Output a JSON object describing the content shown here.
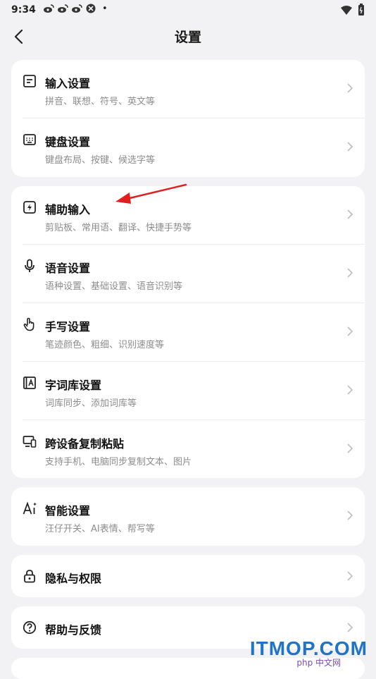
{
  "status": {
    "time": "9:34",
    "notif_icons": [
      "weibo-icon",
      "weibo-icon",
      "weibo-icon",
      "app-icon",
      "dot-icon"
    ]
  },
  "header": {
    "title": "设置"
  },
  "groups": [
    {
      "items": [
        {
          "title": "输入设置",
          "subtitle": "拼音、联想、符号、英文等",
          "icon": "input-settings-icon"
        },
        {
          "title": "键盘设置",
          "subtitle": "键盘布局、按键、候选字等",
          "icon": "keyboard-icon"
        }
      ]
    },
    {
      "items": [
        {
          "title": "辅助输入",
          "subtitle": "剪贴板、常用语、翻译、快捷手势等",
          "icon": "assist-input-icon"
        },
        {
          "title": "语音设置",
          "subtitle": "语种设置、基础设置、语音识别等",
          "icon": "microphone-icon"
        },
        {
          "title": "手写设置",
          "subtitle": "笔迹颜色、粗细、识别速度等",
          "icon": "hand-icon"
        },
        {
          "title": "字词库设置",
          "subtitle": "词库同步、添加词库等",
          "icon": "dictionary-icon"
        },
        {
          "title": "跨设备复制粘贴",
          "subtitle": "支持手机、电脑同步复制文本、图片",
          "icon": "devices-icon"
        }
      ]
    },
    {
      "items": [
        {
          "title": "智能设置",
          "subtitle": "汪仔开关、AI表情、帮写等",
          "icon": "ai-icon"
        }
      ]
    },
    {
      "items": [
        {
          "title": "隐私与权限",
          "icon": "lock-icon"
        }
      ]
    },
    {
      "items": [
        {
          "title": "帮助与反馈",
          "icon": "help-icon"
        }
      ]
    }
  ],
  "watermark": {
    "text": "ITMOP.COM",
    "sub": "php 中文网"
  },
  "colors": {
    "background": "#f2f2f4",
    "card": "#ffffff",
    "annotation_arrow": "#e02020",
    "watermark": "#1f73c9"
  }
}
